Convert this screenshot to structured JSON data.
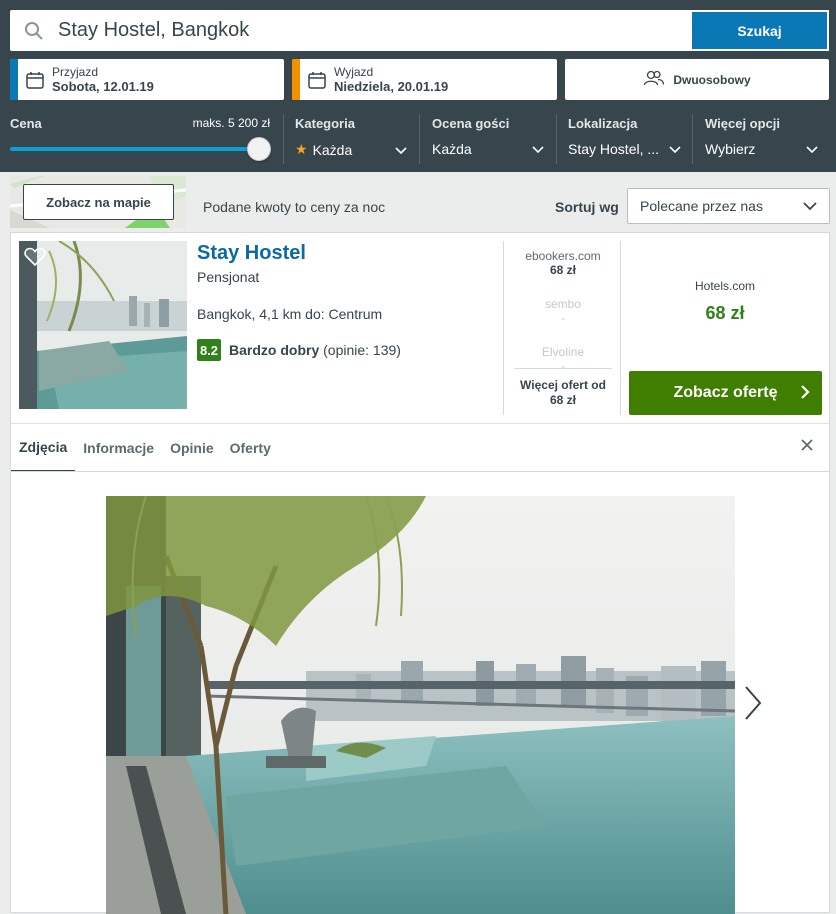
{
  "search": {
    "value": "Stay Hostel, Bangkok",
    "button_label": "Szukaj"
  },
  "checkin": {
    "label": "Przyjazd",
    "value": "Sobota, 12.01.19",
    "accent": "#0a78b4"
  },
  "checkout": {
    "label": "Wyjazd",
    "value": "Niedziela, 20.01.19",
    "accent": "#f48f00"
  },
  "room": {
    "label": "Dwuosobowy"
  },
  "filters": {
    "price": {
      "label": "Cena",
      "max_label": "maks. 5 200 zł",
      "level": 1.0
    },
    "category": {
      "label": "Kategoria",
      "value": "Każda"
    },
    "rating": {
      "label": "Ocena gości",
      "value": "Każda"
    },
    "location": {
      "label": "Lokalizacja",
      "value": "Stay Hostel, ..."
    },
    "more": {
      "label": "Więcej opcji",
      "value": "Wybierz"
    }
  },
  "map_button": "Zobacz na mapie",
  "price_note": "Podane kwoty to ceny za noc",
  "sort": {
    "label": "Sortuj wg",
    "value": "Polecane przez nas"
  },
  "hotel": {
    "name": "Stay Hostel",
    "type": "Pensjonat",
    "location": "Bangkok, 4,1 km do: Centrum",
    "score": "8.2",
    "rating_word": "Bardzo dobry",
    "reviews": "(opinie: 139)",
    "offers": [
      {
        "site": "ebookers.com",
        "price": "68 zł"
      },
      {
        "site": "sembo",
        "price": "-"
      },
      {
        "site": "Elvoline",
        "price": "-"
      }
    ],
    "more_offers_line1": "Więcej ofert od",
    "more_offers_line2": "68 zł",
    "best_site": "Hotels.com",
    "best_price": "68 zł",
    "deal_button": "Zobacz ofertę"
  },
  "tabs": [
    "Zdjęcia",
    "Informacje",
    "Opinie",
    "Oferty"
  ],
  "colors": {
    "header_bg": "#37454d",
    "primary": "#0a78b4",
    "deal": "#3f7e00",
    "score": "#31811b"
  }
}
